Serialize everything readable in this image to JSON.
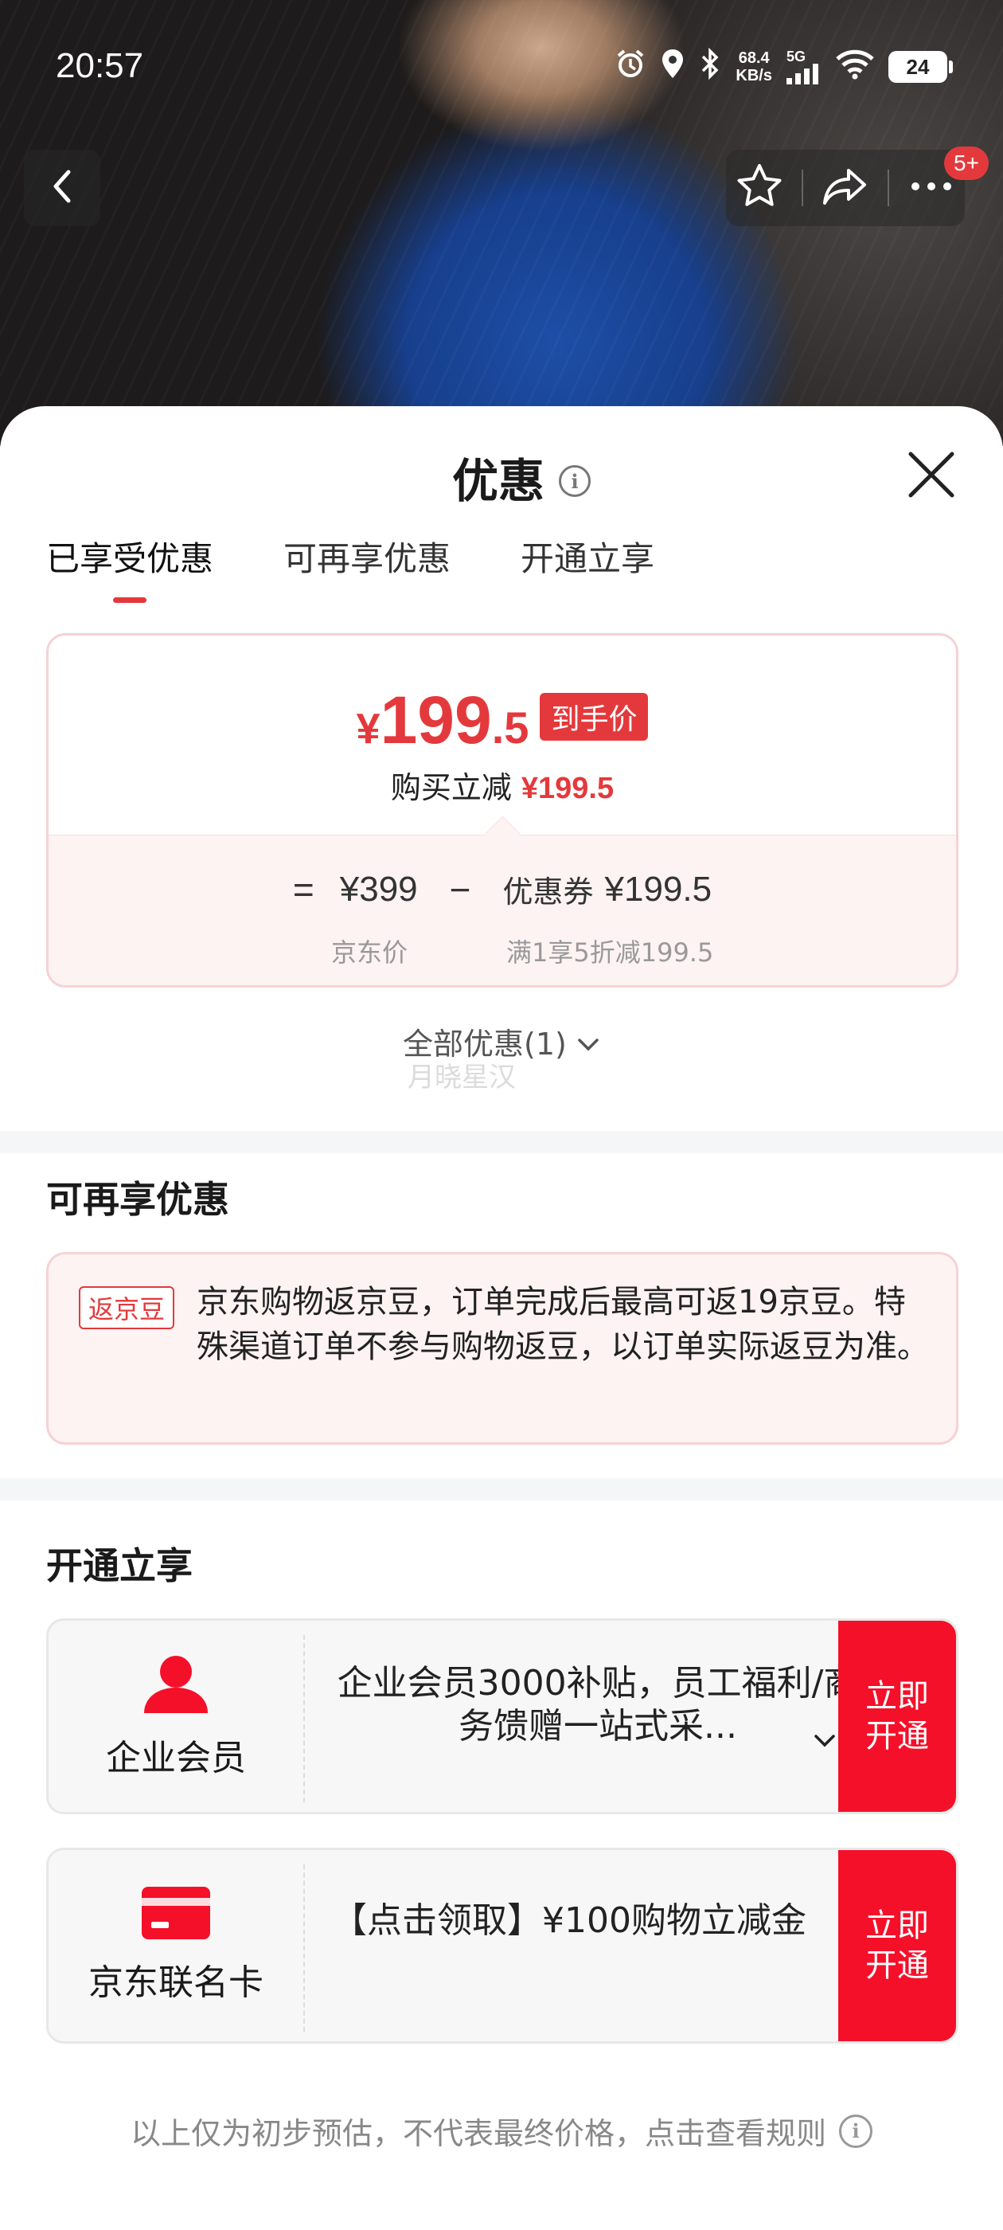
{
  "status_bar": {
    "time": "20:57",
    "net_speed_value": "68.4",
    "net_speed_unit": "KB/s",
    "network": "5G",
    "battery": "24"
  },
  "header": {
    "cart_badge": "5+"
  },
  "sheet": {
    "title": "优惠",
    "tabs": [
      "已享受优惠",
      "可再享优惠",
      "开通立享"
    ],
    "active_tab": 0
  },
  "price_card": {
    "final_currency": "¥",
    "final_int": "199",
    "final_dec": ".5",
    "final_tag": "到手价",
    "reduce_label": "购买立减",
    "reduce_value": "¥199.5",
    "eq": "=",
    "jd_price": "¥399",
    "minus": "−",
    "coupon_label": "优惠券",
    "coupon_value": "¥199.5",
    "jd_price_label": "京东价",
    "coupon_rule": "满1享5折减199.5"
  },
  "all_discounts": "全部优惠(1)",
  "watermark": "月晓星汉",
  "extra_section": {
    "title": "可再享优惠",
    "tag": "返京豆",
    "text": "京东购物返京豆，订单完成后最高可返19京豆。特殊渠道订单不参与购物返豆，以订单实际返豆为准。"
  },
  "open_section": {
    "title": "开通立享",
    "items": [
      {
        "name": "企业会员",
        "desc": "企业会员3000补贴，员工福利/商务馈赠一站式采...",
        "button": "立即开通"
      },
      {
        "name": "京东联名卡",
        "desc": "【点击领取】¥100购物立减金",
        "button": "立即开通"
      }
    ]
  },
  "footer_note": "以上仅为初步预估，不代表最终价格，点击查看规则",
  "colors": {
    "accent": "#e4393c",
    "button_red": "#f5102a",
    "card_pink_bg": "#fdf3f3",
    "card_pink_border": "#f6d2d4"
  }
}
